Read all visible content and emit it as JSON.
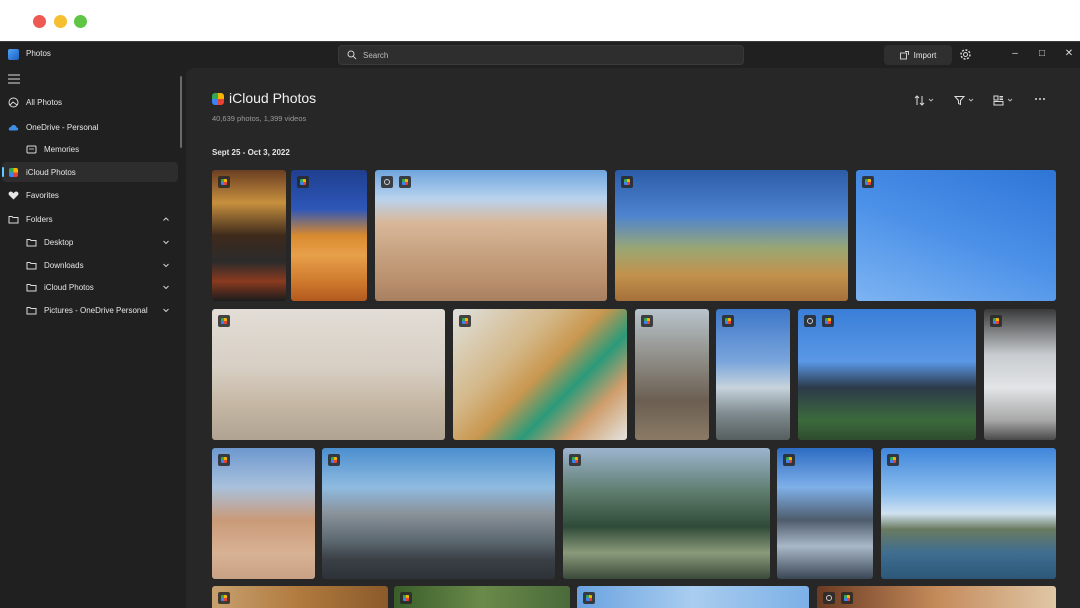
{
  "window": {
    "app_title": "Photos",
    "search_placeholder": "Search",
    "import_label": "Import"
  },
  "sidebar": {
    "items": [
      {
        "label": "All Photos",
        "icon": "all-photos-icon"
      },
      {
        "label": "OneDrive - Personal",
        "icon": "cloud-icon"
      },
      {
        "label": "Memories",
        "icon": "memories-icon"
      },
      {
        "label": "iCloud Photos",
        "icon": "icloud-photos-icon"
      },
      {
        "label": "Favorites",
        "icon": "heart-icon"
      },
      {
        "label": "Folders",
        "icon": "folder-icon"
      },
      {
        "label": "Desktop",
        "icon": "folder-icon"
      },
      {
        "label": "Downloads",
        "icon": "folder-icon"
      },
      {
        "label": "iCloud Photos",
        "icon": "folder-icon"
      },
      {
        "label": "Pictures - OneDrive Personal",
        "icon": "folder-icon"
      }
    ],
    "active_index": 3
  },
  "header": {
    "title": "iCloud Photos",
    "subtitle": "40,639 photos, 1,399 videos"
  },
  "gallery": {
    "date_range": "Sept 25 - Oct 3, 2022"
  },
  "colors": {
    "window_bg": "#202020",
    "main_bg": "#272727",
    "accent": "#60cdff"
  }
}
